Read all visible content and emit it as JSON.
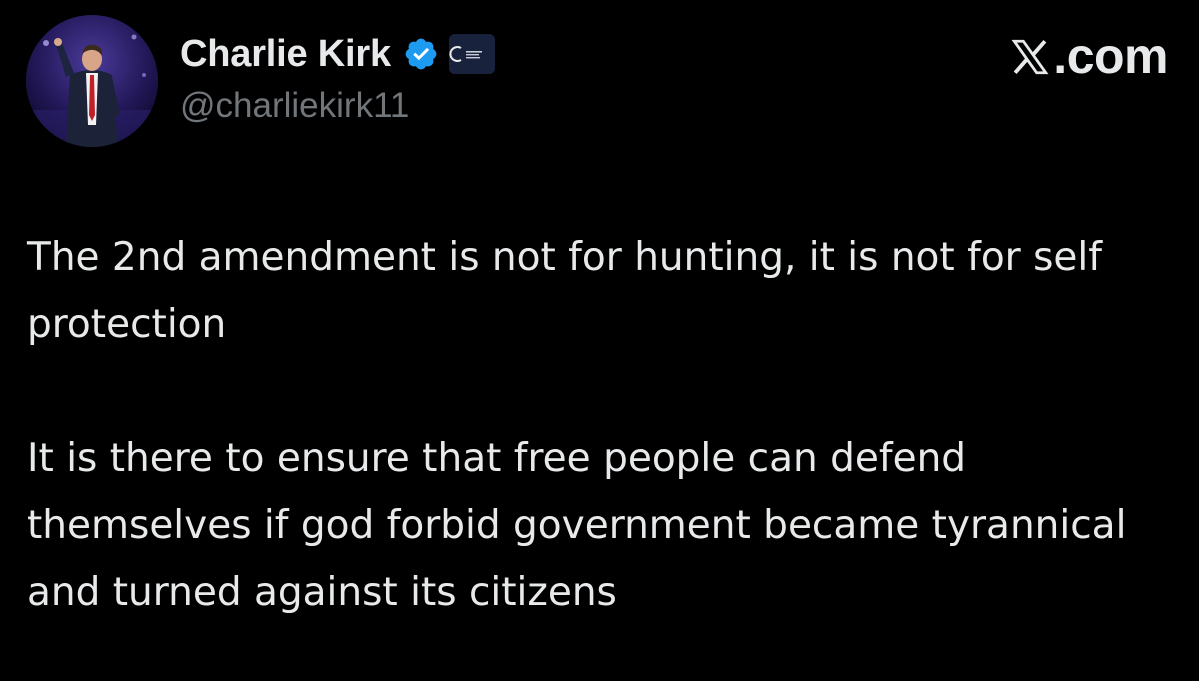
{
  "author": {
    "display_name": "Charlie Kirk",
    "handle": "@charliekirk11",
    "verified_icon": "verified-checkmark-icon",
    "affiliate_icon": "organization-affiliate-badge",
    "avatar_icon": "profile-photo"
  },
  "site": {
    "logo_icon": "x-logo-icon",
    "domain": ".com"
  },
  "tweet": {
    "paragraphs": [
      "The 2nd amendment is not for hunting, it is not for self protection",
      "It is there to ensure that free people can defend themselves if god forbid government became tyrannical and turned against its citizens"
    ]
  },
  "colors": {
    "background": "#000000",
    "text_primary": "#e7e9ea",
    "text_secondary": "#71767b",
    "verified_blue": "#1d9bf0"
  }
}
